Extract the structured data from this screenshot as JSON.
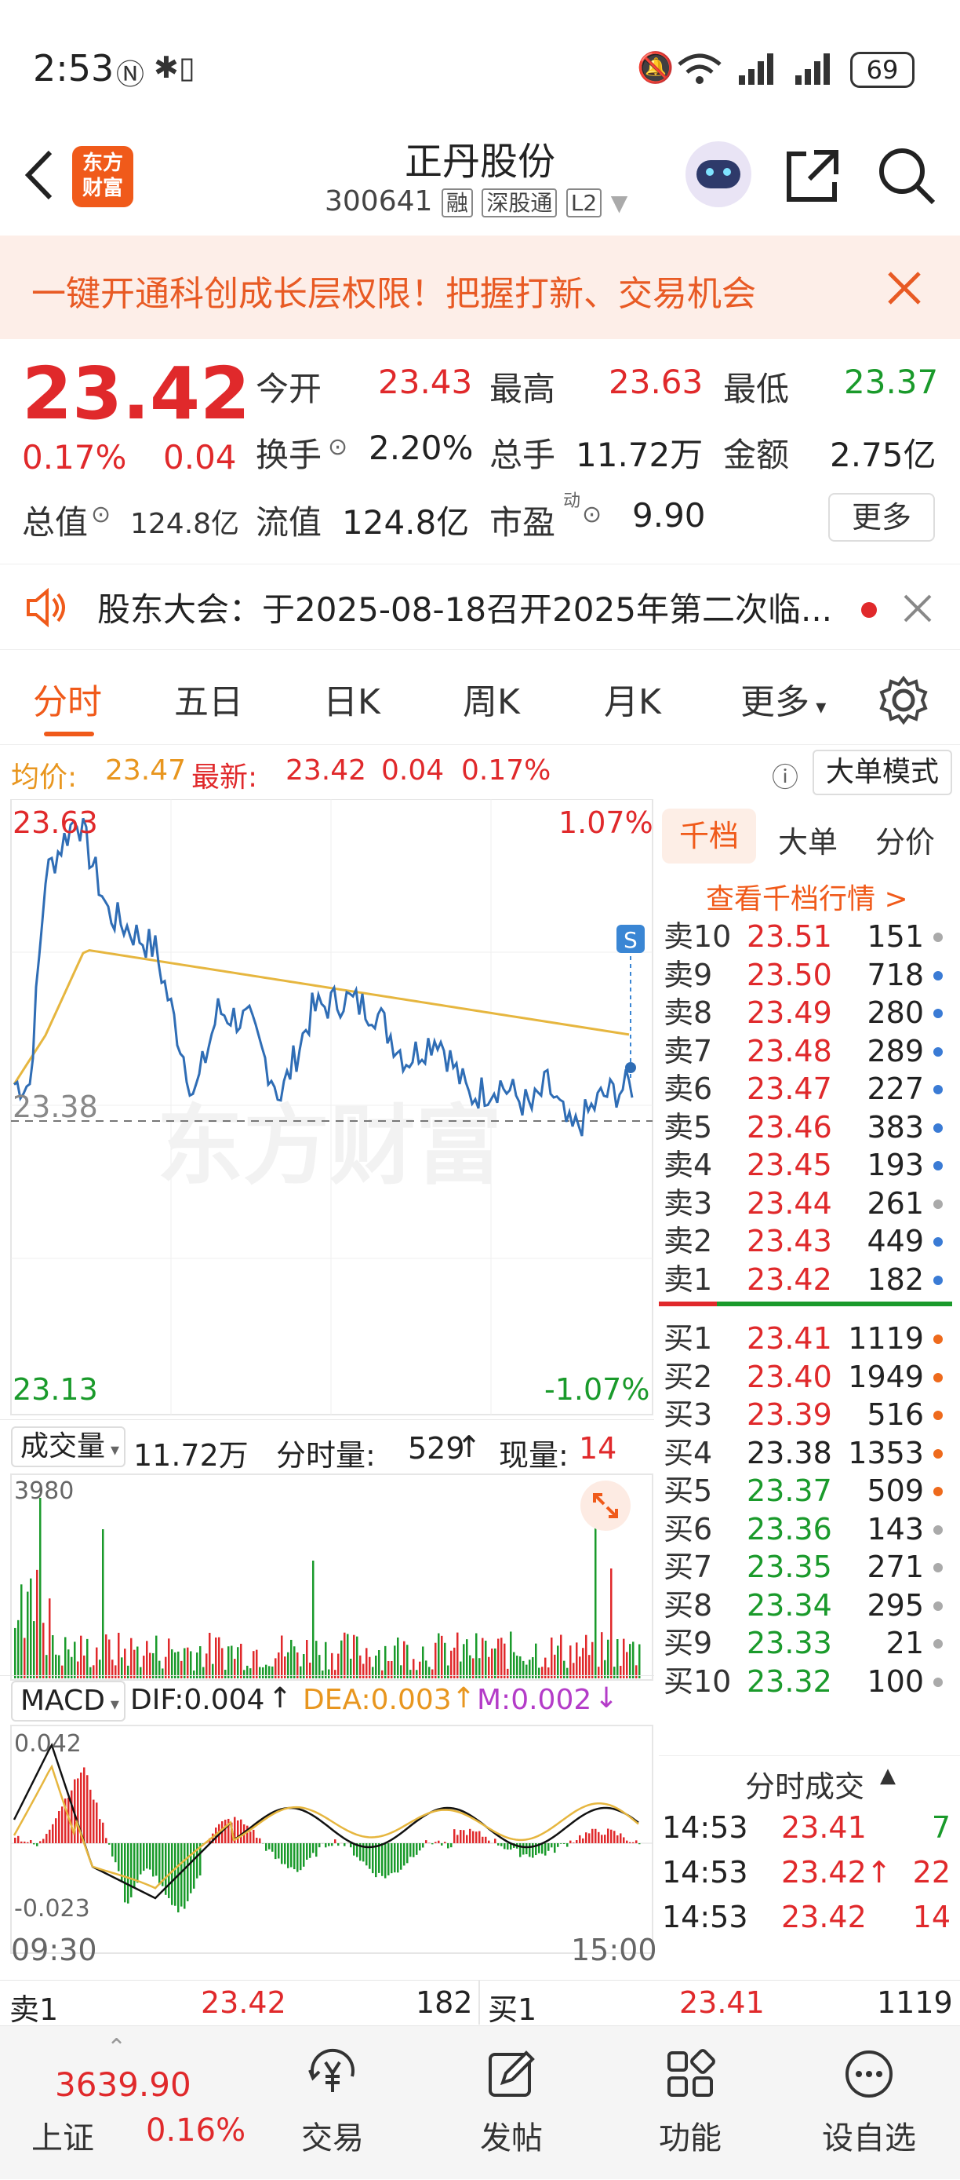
{
  "status": {
    "time": "2:53",
    "battery": "69"
  },
  "header": {
    "logo": "东方\n财富",
    "logo_l1": "东方",
    "logo_l2": "财富",
    "title": "正丹股份",
    "code": "300641",
    "badge_rong": "融",
    "badge_sgt": "深股通",
    "badge_l2": "L2"
  },
  "banner": {
    "text": "一键开通科创成长层权限！把握打新、交易机会"
  },
  "quote": {
    "price": "23.42",
    "change_pct": "0.17%",
    "change": "0.04",
    "open_label": "今开",
    "open": "23.43",
    "high_label": "最高",
    "high": "23.63",
    "low_label": "最低",
    "low": "23.37",
    "turnover_label": "换手",
    "turnover": "2.20%",
    "volume_label": "总手",
    "volume": "11.72万",
    "amount_label": "金额",
    "amount": "2.75亿",
    "mcap_label": "总值",
    "mcap": "124.8亿",
    "float_label": "流值",
    "float": "124.8亿",
    "pe_label": "市盈",
    "pe_sup": "动",
    "pe": "9.90",
    "more": "更多"
  },
  "notice": {
    "text": "股东大会：于2025-08-18召开2025年第二次临..."
  },
  "tabs": [
    "分时",
    "五日",
    "日K",
    "周K",
    "月K",
    "更多"
  ],
  "infobar": {
    "avg_label": "均价:",
    "avg": "23.47",
    "latest_label": "最新:",
    "latest": "23.42",
    "chg": "0.04",
    "pct": "0.17%",
    "mode": "大单模式"
  },
  "chart": {
    "top": "23.63",
    "top_pct": "1.07%",
    "base": "23.38",
    "bottom": "23.13",
    "bottom_pct": "-1.07%",
    "watermark": "东方财富",
    "s_badge": "S"
  },
  "volume": {
    "label": "成交量",
    "total": "11.72万",
    "tick_label": "分时量:",
    "tick": "529",
    "tick_arrow": "↑",
    "now_label": "现量:",
    "now": "14",
    "max": "3980"
  },
  "macd": {
    "label": "MACD",
    "dif": "DIF:0.004",
    "dif_arrow": "↑",
    "dea": "DEA:0.003",
    "dea_arrow": "↑",
    "m": "M:0.002",
    "m_arrow": "↓",
    "max": "0.042",
    "min": "-0.023",
    "t_start": "09:30",
    "t_end": "15:00"
  },
  "orderbook": {
    "tabs": [
      "千档",
      "大单",
      "分价"
    ],
    "link": "查看千档行情 >",
    "asks": [
      {
        "label": "卖10",
        "price": "23.51",
        "vol": "151",
        "c": "#e0292b",
        "d": "#aaa"
      },
      {
        "label": "卖9",
        "price": "23.50",
        "vol": "718",
        "c": "#e0292b",
        "d": "#3a7bd5"
      },
      {
        "label": "卖8",
        "price": "23.49",
        "vol": "280",
        "c": "#e0292b",
        "d": "#3a7bd5"
      },
      {
        "label": "卖7",
        "price": "23.48",
        "vol": "289",
        "c": "#e0292b",
        "d": "#3a7bd5"
      },
      {
        "label": "卖6",
        "price": "23.47",
        "vol": "227",
        "c": "#e0292b",
        "d": "#3a7bd5"
      },
      {
        "label": "卖5",
        "price": "23.46",
        "vol": "383",
        "c": "#e0292b",
        "d": "#3a7bd5"
      },
      {
        "label": "卖4",
        "price": "23.45",
        "vol": "193",
        "c": "#e0292b",
        "d": "#3a7bd5"
      },
      {
        "label": "卖3",
        "price": "23.44",
        "vol": "261",
        "c": "#e0292b",
        "d": "#aaa"
      },
      {
        "label": "卖2",
        "price": "23.43",
        "vol": "449",
        "c": "#e0292b",
        "d": "#3a7bd5"
      },
      {
        "label": "卖1",
        "price": "23.42",
        "vol": "182",
        "c": "#e0292b",
        "d": "#3a7bd5"
      }
    ],
    "bids": [
      {
        "label": "买1",
        "price": "23.41",
        "vol": "1119",
        "c": "#e0292b",
        "d": "#ee6a1c"
      },
      {
        "label": "买2",
        "price": "23.40",
        "vol": "1949",
        "c": "#e0292b",
        "d": "#ee6a1c"
      },
      {
        "label": "买3",
        "price": "23.39",
        "vol": "516",
        "c": "#e0292b",
        "d": "#ee6a1c"
      },
      {
        "label": "买4",
        "price": "23.38",
        "vol": "1353",
        "c": "#222",
        "d": "#ee6a1c"
      },
      {
        "label": "买5",
        "price": "23.37",
        "vol": "509",
        "c": "#1a9a2b",
        "d": "#ee6a1c"
      },
      {
        "label": "买6",
        "price": "23.36",
        "vol": "143",
        "c": "#1a9a2b",
        "d": "#aaa"
      },
      {
        "label": "买7",
        "price": "23.35",
        "vol": "271",
        "c": "#1a9a2b",
        "d": "#aaa"
      },
      {
        "label": "买8",
        "price": "23.34",
        "vol": "295",
        "c": "#1a9a2b",
        "d": "#aaa"
      },
      {
        "label": "买9",
        "price": "23.33",
        "vol": "21",
        "c": "#1a9a2b",
        "d": "#aaa"
      },
      {
        "label": "买10",
        "price": "23.32",
        "vol": "100",
        "c": "#1a9a2b",
        "d": "#aaa"
      }
    ],
    "trades_title": "分时成交",
    "trades": [
      {
        "t": "14:53",
        "p": "23.41",
        "arrow": "",
        "v": "7",
        "vc": "#1a9a2b"
      },
      {
        "t": "14:53",
        "p": "23.42",
        "arrow": "↑",
        "v": "22",
        "vc": "#e0292b"
      },
      {
        "t": "14:53",
        "p": "23.42",
        "arrow": "",
        "v": "14",
        "vc": "#e0292b"
      }
    ]
  },
  "bottom_quote": {
    "ask_label": "卖1",
    "ask": "23.42",
    "ask_vol": "182",
    "bid_label": "买1",
    "bid": "23.41",
    "bid_vol": "1119"
  },
  "footer": {
    "index": "3639.90",
    "index_name": "上证",
    "index_pct": "0.16%",
    "tabs": [
      "交易",
      "发帖",
      "功能",
      "设自选"
    ]
  },
  "colors": {
    "up": "#e0292b",
    "down": "#1a9a2b",
    "price_line": "#2f6db5",
    "avg_line": "#e6b63f",
    "accent": "#f05a1a"
  }
}
